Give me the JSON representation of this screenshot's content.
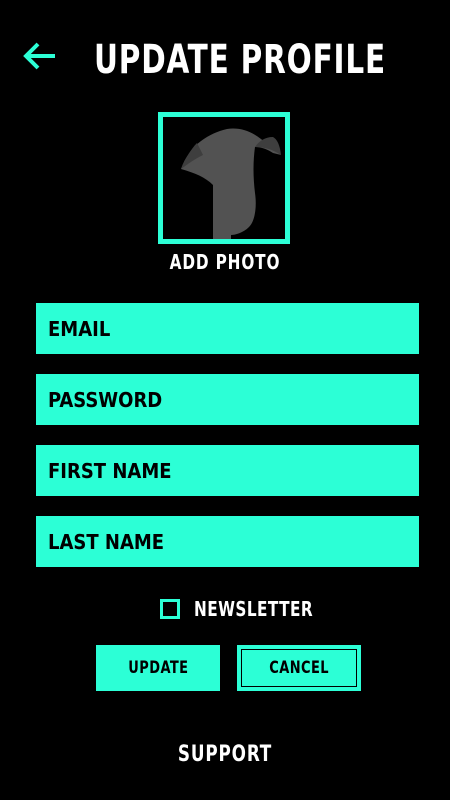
{
  "header": {
    "title": "UPDATE PROFILE",
    "back_icon": "arrow-left-icon"
  },
  "photo": {
    "label": "ADD PHOTO",
    "icon": "greyhound-silhouette-icon"
  },
  "form": {
    "email_placeholder": "EMAIL",
    "password_placeholder": "PASSWORD",
    "first_name_placeholder": "FIRST NAME",
    "last_name_placeholder": "LAST NAME",
    "newsletter_label": "NEWSLETTER",
    "newsletter_checked": false
  },
  "actions": {
    "update_label": "UPDATE",
    "cancel_label": "CANCEL"
  },
  "footer": {
    "support_label": "SUPPORT"
  },
  "colors": {
    "accent": "#2cffd6",
    "background": "#000000",
    "text": "#ffffff"
  }
}
